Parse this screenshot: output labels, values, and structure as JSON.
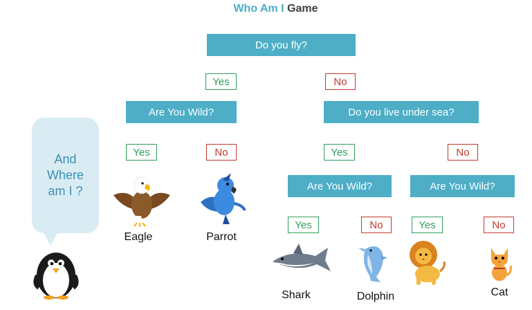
{
  "title": {
    "part1": "Who Am I",
    "part2": "Game"
  },
  "questions": {
    "root": "Do you fly?",
    "fly_yes": "Are You Wild?",
    "fly_no": "Do you live under sea?",
    "sea_yes": "Are You Wild?",
    "sea_no": "Are You Wild?"
  },
  "answers": {
    "root_yes": "Yes",
    "root_no": "No",
    "wild1_yes": "Yes",
    "wild1_no": "No",
    "sea_yes": "Yes",
    "sea_no": "No",
    "wild2_yes": "Yes",
    "wild2_no": "No",
    "wild3_yes": "Yes",
    "wild3_no": "No"
  },
  "animals": {
    "eagle": "Eagle",
    "parrot": "Parrot",
    "shark": "Shark",
    "dolphin": "Dolphin",
    "cat": "Cat"
  },
  "bubble": {
    "line1": "And",
    "line2": "Where",
    "line3": "am I ?"
  },
  "colors": {
    "question_bg": "#4DAEC6",
    "yes": "#2E9E5B",
    "no": "#C0392B",
    "bubble_bg": "#D9ECF3",
    "bubble_text": "#3B8FB6"
  },
  "icons": {
    "eagle": "eagle-cartoon-icon",
    "parrot": "parrot-cartoon-icon",
    "shark": "shark-cartoon-icon",
    "dolphin": "dolphin-cartoon-icon",
    "lion": "lion-cartoon-icon",
    "cat": "cat-cartoon-icon",
    "penguin": "penguin-cartoon-icon"
  }
}
